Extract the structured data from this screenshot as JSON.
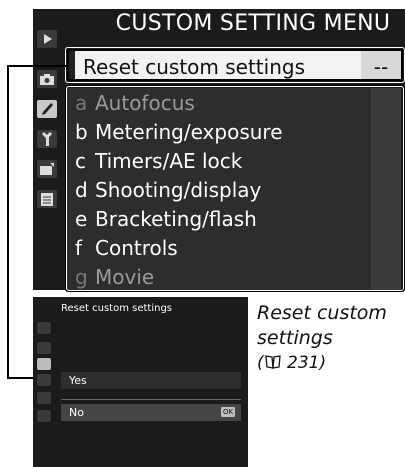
{
  "top_screen": {
    "title": "CUSTOM SETTING MENU",
    "reset_row": {
      "label": "Reset custom settings",
      "value": "--"
    },
    "groups": [
      {
        "letter": "a",
        "label": "Autofocus",
        "dim": true
      },
      {
        "letter": "b",
        "label": "Metering/exposure",
        "dim": false
      },
      {
        "letter": "c",
        "label": "Timers/AE lock",
        "dim": false
      },
      {
        "letter": "d",
        "label": "Shooting/display",
        "dim": false
      },
      {
        "letter": "e",
        "label": "Bracketing/flash",
        "dim": false
      },
      {
        "letter": "f",
        "label": "Controls",
        "dim": false
      },
      {
        "letter": "g",
        "label": "Movie",
        "dim": true
      }
    ],
    "tabs": [
      "playback-icon",
      "camera-icon",
      "pencil-icon",
      "wrench-icon",
      "retouch-icon",
      "my-menu-icon"
    ]
  },
  "bottom_screen": {
    "title": "Reset custom settings",
    "options": [
      {
        "label": "Yes",
        "selected": false
      },
      {
        "label": "No",
        "selected": true
      }
    ],
    "ok_label": "OK"
  },
  "caption": {
    "line1": "Reset custom",
    "line2": "settings",
    "ref": "231)"
  },
  "colors": {
    "screen_bg": "#1b1b1b",
    "row_bg": "#2d2d2d",
    "highlight_bg": "#f2f2f2",
    "text": "#ffffff"
  }
}
